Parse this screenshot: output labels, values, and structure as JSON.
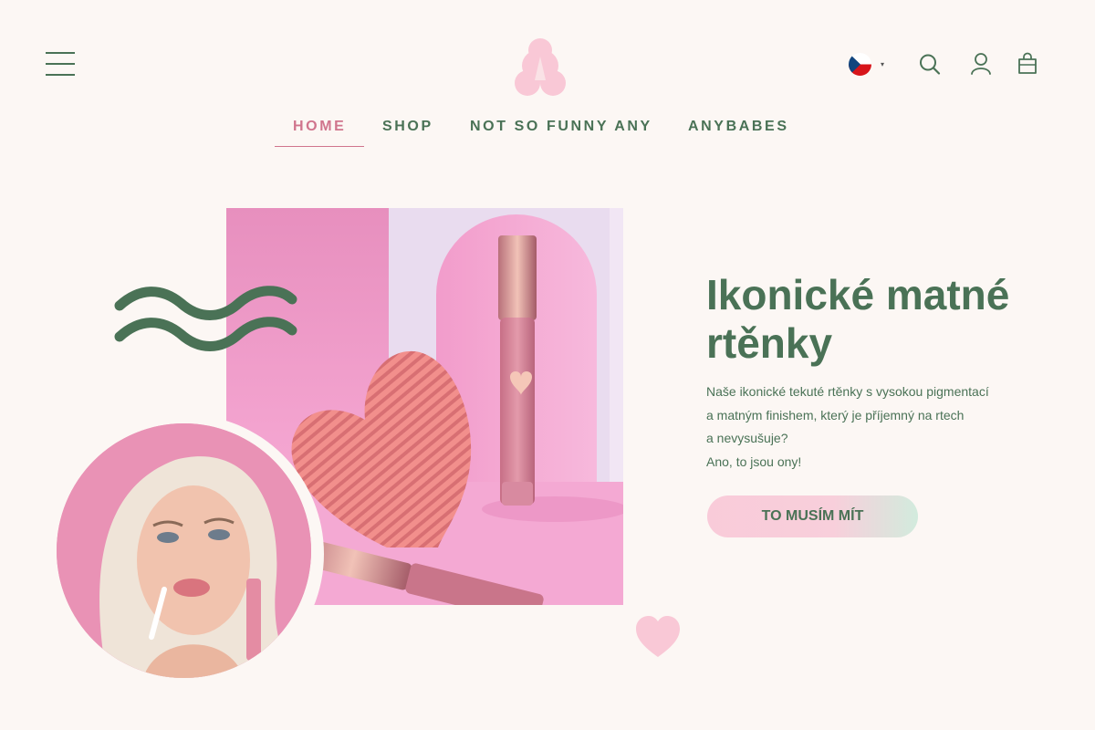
{
  "header": {
    "menu_icon": "hamburger-menu-icon",
    "logo_letter": "A",
    "language": {
      "flag": "czech-flag-icon",
      "caret": "▾"
    },
    "icons": [
      "search-icon",
      "account-icon",
      "cart-bag-icon"
    ]
  },
  "nav": {
    "items": [
      {
        "label": "HOME",
        "active": true
      },
      {
        "label": "SHOP",
        "active": false
      },
      {
        "label": "NOT SO FUNNY ANY",
        "active": false
      },
      {
        "label": "ANYBABES",
        "active": false
      }
    ]
  },
  "hero": {
    "title": "Ikonické matné rtěnky",
    "description": [
      "Naše ikonické tekuté rtěnky s vysokou pigmentací",
      "a matným finishem, který je příjemný na rtech",
      "a nevysušuje?",
      "Ano, to jsou ony!"
    ],
    "cta_label": "TO MUSÍM MÍT"
  },
  "colors": {
    "brand_green": "#4a7256",
    "brand_pink": "#d0758d",
    "logo_pink": "#f9c8d6",
    "background": "#fcf7f4"
  }
}
